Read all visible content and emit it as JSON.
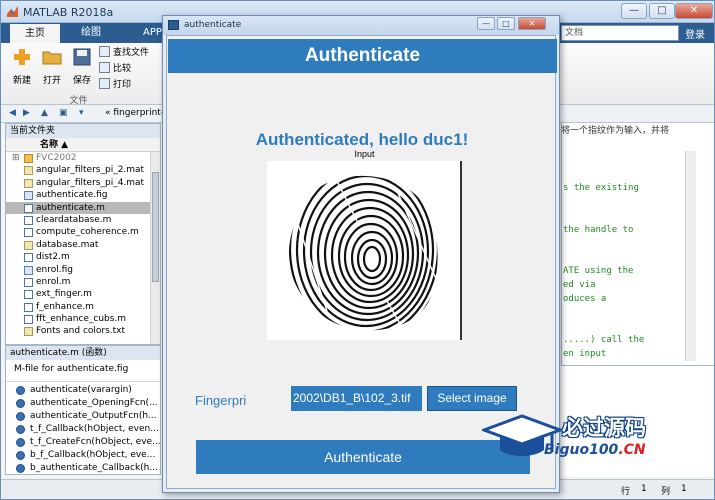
{
  "matlab": {
    "window_title": "MATLAB R2018a",
    "window_controls": {
      "minimize": "—",
      "maximize": "□",
      "close": "✕"
    },
    "tabs": [
      "主页",
      "绘图",
      "APP"
    ],
    "search_placeholder": "文档",
    "login": "登录",
    "ribbon": {
      "new": "新建",
      "open": "打开",
      "save": "保存",
      "find_files": "查找文件",
      "compare": "比较",
      "print": "打印",
      "group_label": "文件"
    },
    "address_path": "« fingerprint-rec",
    "current_folder": {
      "header": "当前文件夹",
      "column_name": "名称 ▲",
      "files": [
        {
          "name": "FVC2002",
          "type": "folder"
        },
        {
          "name": "angular_filters_pi_2.mat",
          "type": "mat"
        },
        {
          "name": "angular_filters_pi_4.mat",
          "type": "mat"
        },
        {
          "name": "authenticate.fig",
          "type": "fig"
        },
        {
          "name": "authenticate.m",
          "type": "mfile",
          "selected": true
        },
        {
          "name": "cleardatabase.m",
          "type": "mfile"
        },
        {
          "name": "compute_coherence.m",
          "type": "mfile"
        },
        {
          "name": "database.mat",
          "type": "mat"
        },
        {
          "name": "dist2.m",
          "type": "mfile"
        },
        {
          "name": "enrol.fig",
          "type": "fig"
        },
        {
          "name": "enrol.m",
          "type": "mfile"
        },
        {
          "name": "ext_finger.m",
          "type": "mfile"
        },
        {
          "name": "f_enhance.m",
          "type": "mfile"
        },
        {
          "name": "fft_enhance_cubs.m",
          "type": "mfile"
        },
        {
          "name": "Fonts and colors.txt",
          "type": "txt"
        }
      ]
    },
    "details": {
      "header": "authenticate.m  (函数)",
      "description": "M-file for authenticate.fig",
      "functions": [
        "authenticate(varargin)",
        "authenticate_OpeningFcn(...",
        "authenticate_OutputFcn(h...",
        "t_f_Callback(hObject, even...",
        "t_f_CreateFcn(hObject, eve...",
        "b_f_Callback(hObject, eve...",
        "b_authenticate_Callback(h..."
      ]
    },
    "editor_hint": "将一个指纹作为输入，并将",
    "code_lines": [
      "s the existing",
      "the handle to",
      "ATE using the",
      "ed via",
      "oduces a",
      ".....) call the",
      "en input"
    ],
    "status": {
      "row_label": "行",
      "row": "1",
      "col_label": "列",
      "col": "1"
    }
  },
  "auth_window": {
    "title": "authenticate",
    "header": "Authenticate",
    "status_message": "Authenticated, hello duc1!",
    "image_title": "Input",
    "fingerprint_label": "Fingerpri",
    "file_path": "2002\\DB1_B\\102_3.tif",
    "select_button": "Select image",
    "authenticate_button": "Authenticate"
  },
  "watermark": {
    "cn": "必过源码",
    "en_main": "Biguo100",
    "en_suffix": ".CN"
  },
  "colors": {
    "accent": "#2e7bbe",
    "matlab_tabbar": "#2b5d91"
  }
}
